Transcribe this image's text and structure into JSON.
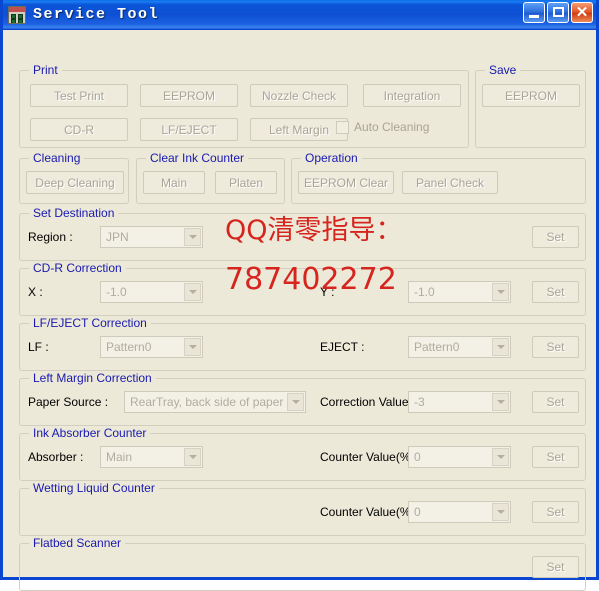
{
  "window": {
    "title": "Service Tool",
    "icon": "printer-chip-icon",
    "controls": {
      "minimize": "minimize-button",
      "maximize": "maximize-button",
      "close": "✕"
    }
  },
  "groups": {
    "print": {
      "legend": "Print",
      "buttons": [
        "Test Print",
        "EEPROM",
        "Nozzle Check",
        "CD-R",
        "LF/EJECT",
        "Left Margin"
      ],
      "chevron": "≫",
      "integration": "Integration",
      "auto_cleaning": "Auto Cleaning"
    },
    "save": {
      "legend": "Save",
      "eeprom": "EEPROM"
    },
    "cleaning": {
      "legend": "Cleaning",
      "deep_cleaning": "Deep Cleaning"
    },
    "clear_ink_counter": {
      "legend": "Clear Ink Counter",
      "main": "Main",
      "platen": "Platen"
    },
    "operation": {
      "legend": "Operation",
      "eeprom_clear": "EEPROM Clear",
      "panel_check": "Panel Check"
    },
    "set_destination": {
      "legend": "Set Destination",
      "region_label": "Region :",
      "region_value": "JPN",
      "set": "Set"
    },
    "cdr_correction": {
      "legend": "CD-R Correction",
      "x_label": "X :",
      "x_value": "-1.0",
      "y_label": "Y :",
      "y_value": "-1.0",
      "set": "Set"
    },
    "lf_eject_correction": {
      "legend": "LF/EJECT Correction",
      "lf_label": "LF :",
      "lf_value": "Pattern0",
      "eject_label": "EJECT :",
      "eject_value": "Pattern0",
      "set": "Set"
    },
    "left_margin_correction": {
      "legend": "Left Margin Correction",
      "paper_source_label": "Paper Source :",
      "paper_source_value": "RearTray, back side of paper",
      "correction_label": "Correction Value :",
      "correction_value": "-3",
      "set": "Set"
    },
    "ink_absorber_counter": {
      "legend": "Ink Absorber Counter",
      "absorber_label": "Absorber :",
      "absorber_value": "Main",
      "counter_label": "Counter Value(%) :",
      "counter_value": "0",
      "set": "Set"
    },
    "wetting_liquid_counter": {
      "legend": "Wetting Liquid Counter",
      "counter_label": "Counter Value(%) :",
      "counter_value": "0",
      "set": "Set"
    },
    "flatbed_scanner": {
      "legend": "Flatbed Scanner",
      "set": "Set"
    }
  },
  "watermark": {
    "line1": "QQ清零指导：",
    "line2": "787402272",
    "color": "#d6251e"
  },
  "colors": {
    "window_bg": "#ece9d8",
    "title_blue": "#0a55d8",
    "legend_blue": "#1919b0",
    "border": "#0a46cf"
  }
}
